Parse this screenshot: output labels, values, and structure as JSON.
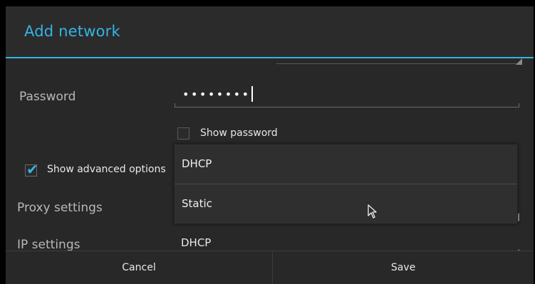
{
  "dialog": {
    "title": "Add network",
    "accent_color": "#33b5e5"
  },
  "security": {
    "spinner_arrow_icon": "spinner-triangle"
  },
  "password": {
    "label": "Password",
    "value": "••••••••",
    "show_password_label": "Show password",
    "show_password_checked": false
  },
  "advanced": {
    "label": "Show advanced options",
    "checked": true
  },
  "proxy": {
    "label": "Proxy settings"
  },
  "ip": {
    "label": "IP settings",
    "value": "DHCP"
  },
  "dropdown": {
    "options": [
      "DHCP",
      "Static"
    ]
  },
  "buttons": {
    "cancel": "Cancel",
    "save": "Save"
  }
}
